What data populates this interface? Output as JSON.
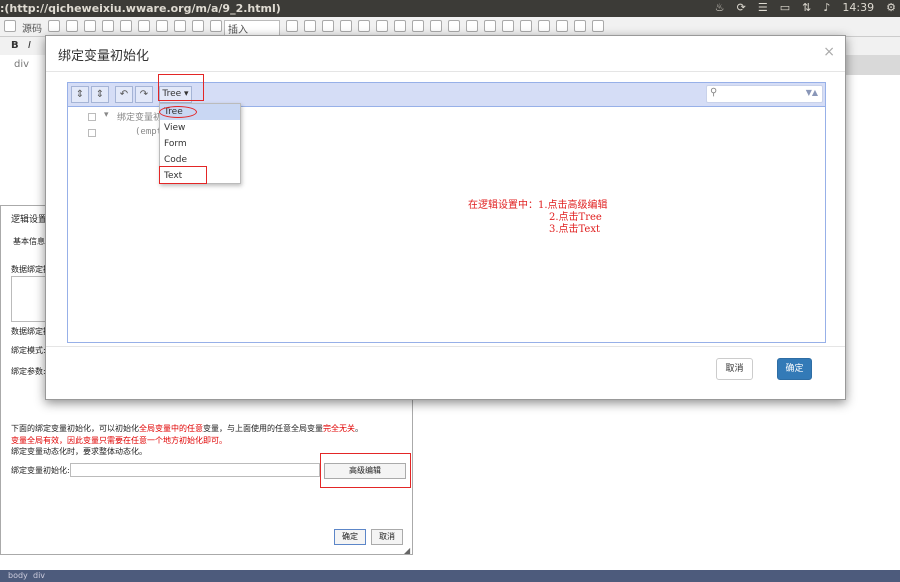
{
  "topbar": {
    "title": ":(http://qicheweixiu.wware.org/m/a/9_2.html)",
    "time": "14:39"
  },
  "editor": {
    "source_label": "源码",
    "insert_label": "插入",
    "path_div": "div",
    "status_path": [
      "body",
      "div"
    ]
  },
  "logic_panel": {
    "title": "逻辑设置",
    "tab_basic": "基本信息",
    "data_bind_label": "数据绑定操",
    "data_bind_label2": "数据绑定操",
    "bind_mode_label": "绑定模式:",
    "bind_params_label": "绑定参数:",
    "note_line1_a": "下面的绑定变量初始化，可以初始化",
    "note_line1_red1": "全局变量中的任意",
    "note_line1_b": "变量，与上面使用的任意全局变量",
    "note_line1_red2": "完全无关",
    "note_line1_c": "。",
    "note_line2": "变量全局有效，因此变量只需要在任意一个地方初始化即可。",
    "note_line3": "绑定变量动态化时，要求整体动态化。",
    "init_label": "绑定变量初始化:",
    "advanced_button": "高级编辑",
    "ok_button": "确定",
    "cancel_button": "取消"
  },
  "modal": {
    "title": "绑定变量初始化",
    "close_symbol": "×",
    "mode_button": "Tree ▾",
    "tree_root": "绑定变量初",
    "tree_empty": "(empt",
    "mode_options": [
      "Tree",
      "View",
      "Form",
      "Code",
      "Text"
    ],
    "selected_mode": "Tree",
    "annotation": {
      "line1": "在逻辑设置中：1.点击高级编辑",
      "line2": "2.点击Tree",
      "line3": "3.点击Text"
    },
    "cancel_button": "取消",
    "ok_button": "确定"
  },
  "colors": {
    "primary": "#337ab7",
    "annotation_red": "#e02020",
    "menu_bar": "#d5ddf6"
  }
}
